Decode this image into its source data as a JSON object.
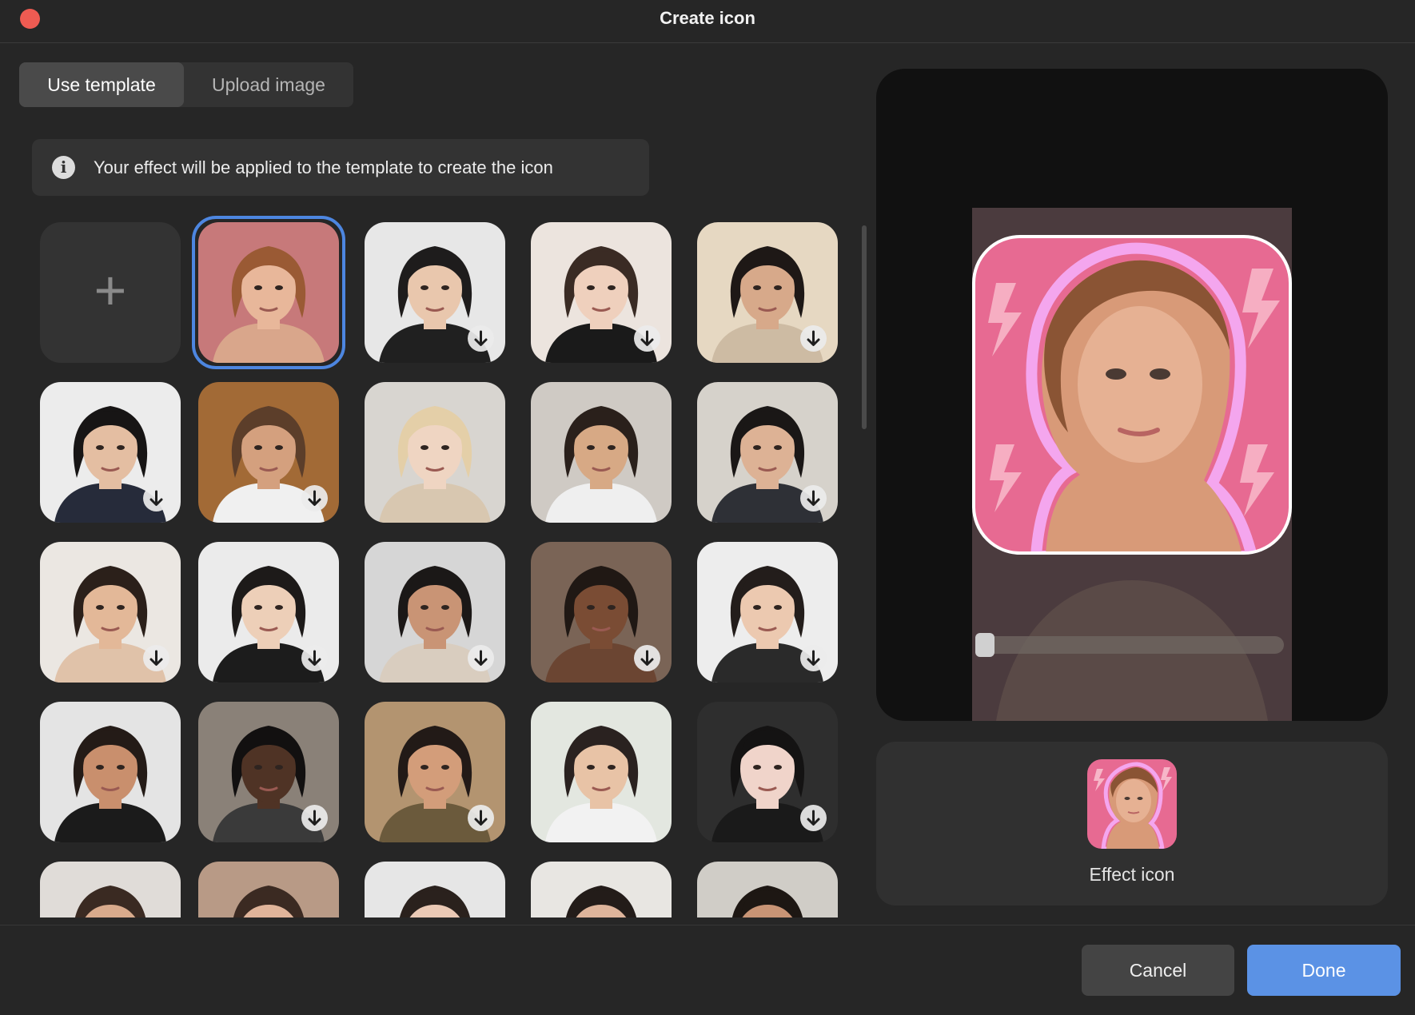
{
  "window": {
    "title": "Create icon"
  },
  "tabs": [
    {
      "label": "Use template",
      "active": true
    },
    {
      "label": "Upload image",
      "active": false
    }
  ],
  "info": {
    "text": "Your effect will be applied to the template to create the icon",
    "icon": "info-icon"
  },
  "templates": {
    "add_icon": "plus-icon",
    "selected_index": 0,
    "items": [
      {
        "name": "template-woman-redhead",
        "skin": "#e8b79a",
        "hair": "#9a5a34",
        "bg": "#c7797a",
        "shirt": "#d9a68b",
        "download": false
      },
      {
        "name": "template-man-suit",
        "skin": "#e9c7ad",
        "hair": "#1e1c1c",
        "bg": "#e7e7e7",
        "shirt": "#202020",
        "download": true
      },
      {
        "name": "template-woman-darkhair",
        "skin": "#efd0bd",
        "hair": "#3a2b24",
        "bg": "#ece4de",
        "shirt": "#1a1a1a",
        "download": true
      },
      {
        "name": "template-woman-smile",
        "skin": "#d7a98a",
        "hair": "#1e1816",
        "bg": "#e6d8c2",
        "shirt": "#cdbba3",
        "download": true
      },
      {
        "name": "template-woman-sleek",
        "skin": "#e4bea2",
        "hair": "#171515",
        "bg": "#ececec",
        "shirt": "#262b3a",
        "download": true
      },
      {
        "name": "template-man-brown",
        "skin": "#d4a07e",
        "hair": "#5c3e2a",
        "bg": "#a26a36",
        "shirt": "#f0f0f0",
        "download": true
      },
      {
        "name": "template-woman-blonde",
        "skin": "#efd5c2",
        "hair": "#e4cfa8",
        "bg": "#d8d5d0",
        "shirt": "#d8c7b0",
        "download": false
      },
      {
        "name": "template-woman-brunette",
        "skin": "#d7a985",
        "hair": "#2a201b",
        "bg": "#cfcac4",
        "shirt": "#efefef",
        "download": false
      },
      {
        "name": "template-man-dark",
        "skin": "#ddb295",
        "hair": "#1a1716",
        "bg": "#d6d2cb",
        "shirt": "#2e3036",
        "download": true
      },
      {
        "name": "template-woman-wavy",
        "skin": "#e3b898",
        "hair": "#2b201a",
        "bg": "#ebe7e2",
        "shirt": "#e0c2a9",
        "download": true
      },
      {
        "name": "template-man-asian",
        "skin": "#edcfb8",
        "hair": "#1d1a19",
        "bg": "#ebebeb",
        "shirt": "#1c1c1c",
        "download": true
      },
      {
        "name": "template-man-beard",
        "skin": "#c99475",
        "hair": "#1b1817",
        "bg": "#d6d6d6",
        "shirt": "#d9cdbf",
        "download": true
      },
      {
        "name": "template-woman-braids",
        "skin": "#7a4c34",
        "hair": "#201814",
        "bg": "#7a6456",
        "shirt": "#6b4532",
        "download": true
      },
      {
        "name": "template-man-young",
        "skin": "#ecc9b0",
        "hair": "#231d1b",
        "bg": "#ededed",
        "shirt": "#2a2a2a",
        "download": true
      },
      {
        "name": "template-man-stubble",
        "skin": "#c98f6d",
        "hair": "#241b17",
        "bg": "#e4e4e4",
        "shirt": "#1b1b1b",
        "download": false
      },
      {
        "name": "template-man-black",
        "skin": "#4f3325",
        "hair": "#121010",
        "bg": "#8a8178",
        "shirt": "#3a3a3a",
        "download": true
      },
      {
        "name": "template-man-tan",
        "skin": "#d39d7a",
        "hair": "#221a17",
        "bg": "#b39470",
        "shirt": "#6b5a3c",
        "download": true
      },
      {
        "name": "template-man-white-tee",
        "skin": "#e8c3a6",
        "hair": "#2a2220",
        "bg": "#e3e7e0",
        "shirt": "#f2f2f2",
        "download": false
      },
      {
        "name": "template-woman-earrings",
        "skin": "#f0d4ca",
        "hair": "#141313",
        "bg": "#2e2e2e",
        "shirt": "#1a1a1a",
        "download": true
      },
      {
        "name": "template-row5-a",
        "skin": "#d8aa8c",
        "hair": "#3a2a22",
        "bg": "#e0dcd8",
        "shirt": "#cccccc",
        "download": false
      },
      {
        "name": "template-row5-b",
        "skin": "#e0b49a",
        "hair": "#3b2a22",
        "bg": "#b89a86",
        "shirt": "#cccccc",
        "download": false
      },
      {
        "name": "template-row5-c",
        "skin": "#eac9b5",
        "hair": "#2a211d",
        "bg": "#e6e6e6",
        "shirt": "#cccccc",
        "download": false
      },
      {
        "name": "template-row5-d",
        "skin": "#ddb49b",
        "hair": "#231c19",
        "bg": "#e8e6e2",
        "shirt": "#cccccc",
        "download": false
      },
      {
        "name": "template-row5-e",
        "skin": "#c89475",
        "hair": "#1d1713",
        "bg": "#d0cdc7",
        "shirt": "#cccccc",
        "download": false
      }
    ]
  },
  "preview": {
    "icon_bg": "#e76a92",
    "accent_outline": "#f4a6ee",
    "slider_value": 0
  },
  "effect": {
    "label": "Effect icon"
  },
  "buttons": {
    "cancel": "Cancel",
    "done": "Done"
  },
  "colors": {
    "accent": "#4d86e0",
    "primary_button": "#5b92e5",
    "close": "#ee5b52"
  }
}
